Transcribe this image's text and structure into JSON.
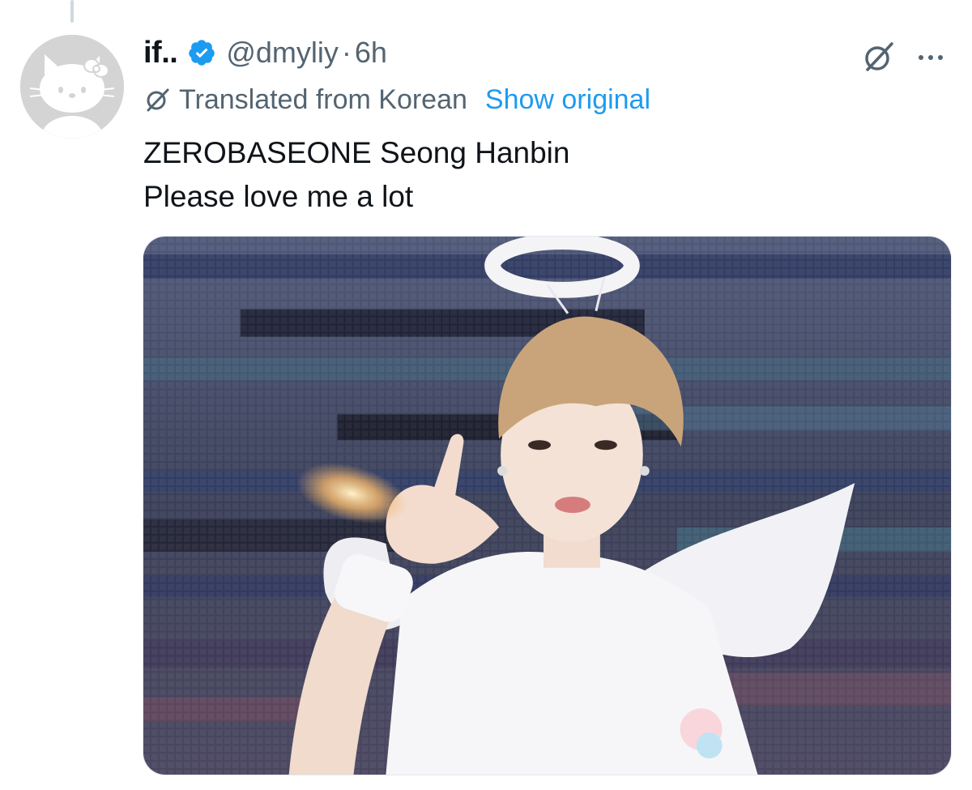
{
  "tweet": {
    "display_name": "if..",
    "handle": "@dmyliy",
    "separator": "·",
    "time": "6h",
    "translation_label": "Translated from Korean",
    "show_original_label": "Show original",
    "text_lines": [
      "ZEROBASEONE Seong Hanbin",
      "Please love me a lot"
    ]
  },
  "icons": {
    "verified": "verified-badge-icon",
    "grok": "grok-icon",
    "more": "more-options-icon",
    "translate": "translate-icon",
    "avatar": "hello-kitty-silhouette"
  },
  "colors": {
    "accent": "#1d9bf0",
    "secondary_text": "#536471",
    "primary_text": "#0f1419"
  }
}
